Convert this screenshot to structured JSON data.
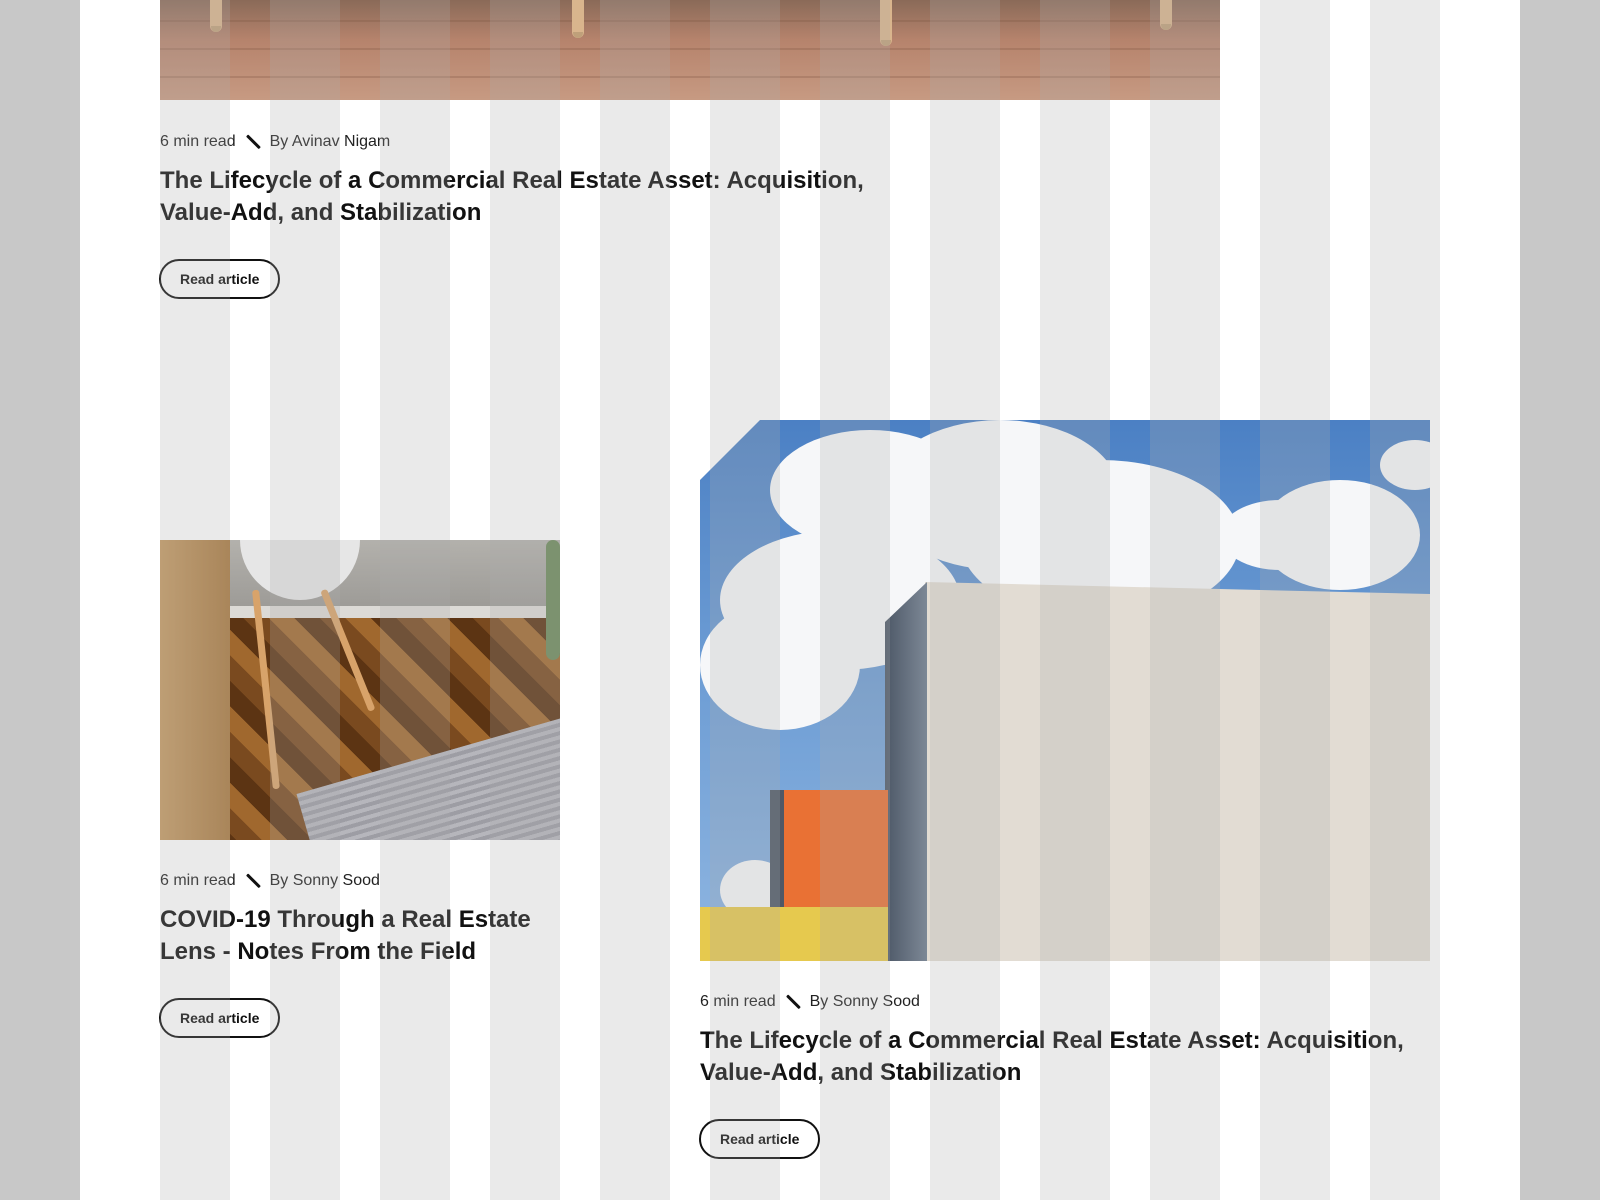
{
  "articles": [
    {
      "read_time": "6 min read",
      "author": "By Avinav Nigam",
      "title_line1": "The Lifecycle of a Commercial Real Estate Asset: Acquisition,",
      "title_line2": "Value-Add, and Stabilization",
      "button_label": "Read article"
    },
    {
      "read_time": "6 min read",
      "author": "By Sonny Sood",
      "title_line1": "COVID-19 Through a Real Estate",
      "title_line2": "Lens - Notes From the Field",
      "button_label": "Read article"
    },
    {
      "read_time": "6 min read",
      "author": "By Sonny Sood",
      "title_line1": "The Lifecycle of a Commercial Real Estate Asset: Acquisition,",
      "title_line2": "Value-Add, and Stabilization",
      "button_label": "Read article"
    }
  ],
  "colors": {
    "background": "#c8c8c8",
    "page": "#ffffff",
    "text": "#111111"
  }
}
